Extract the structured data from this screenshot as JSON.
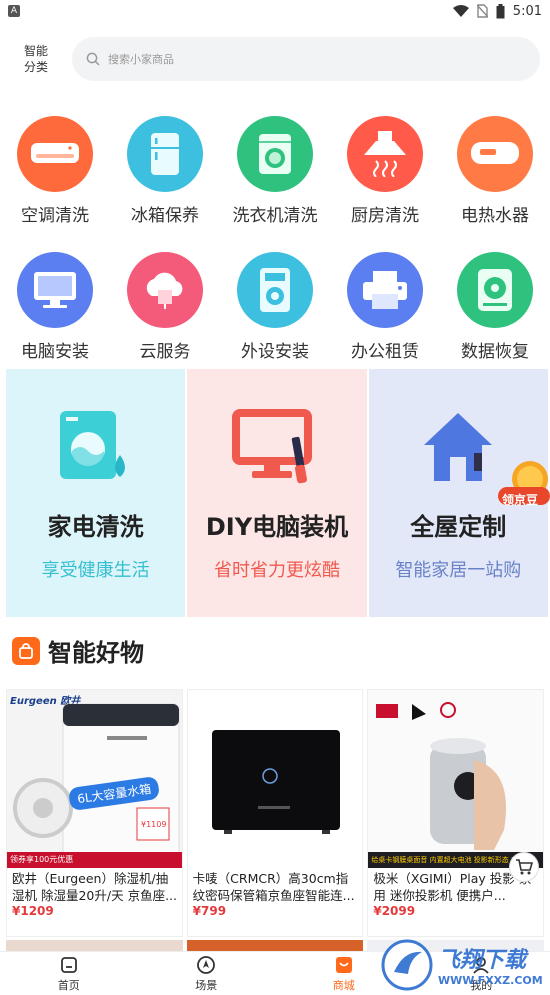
{
  "status_bar": {
    "app_badge": "A",
    "time": "5:01"
  },
  "header": {
    "category_label": "智能\n分类",
    "search_placeholder": "搜索小家商品"
  },
  "services_row1": [
    {
      "label": "空调清洗",
      "icon": "air-conditioner-icon",
      "color": "#ff6a3d"
    },
    {
      "label": "冰箱保养",
      "icon": "fridge-icon",
      "color": "#3dbfe0"
    },
    {
      "label": "洗衣机清洗",
      "icon": "washing-machine-icon",
      "color": "#2ec27e"
    },
    {
      "label": "厨房清洗",
      "icon": "range-hood-icon",
      "color": "#ff5a4a"
    },
    {
      "label": "电热水器",
      "icon": "water-heater-icon",
      "color": "#ff7a45"
    }
  ],
  "services_row2": [
    {
      "label": "电脑安装",
      "icon": "monitor-icon",
      "color": "#5b7ff0"
    },
    {
      "label": "云服务",
      "icon": "cloud-icon",
      "color": "#f45a7a"
    },
    {
      "label": "外设安装",
      "icon": "peripheral-icon",
      "color": "#3dbfe0"
    },
    {
      "label": "办公租赁",
      "icon": "printer-icon",
      "color": "#5b7ff0"
    },
    {
      "label": "数据恢复",
      "icon": "disk-icon",
      "color": "#2ec27e"
    }
  ],
  "features": [
    {
      "title": "家电清洗",
      "subtitle": "享受健康生活",
      "icon": "washer-drop-icon"
    },
    {
      "title": "DIY电脑装机",
      "subtitle": "省时省力更炫酷",
      "icon": "pc-build-icon"
    },
    {
      "title": "全屋定制",
      "subtitle": "智能家居一站购",
      "icon": "house-icon"
    }
  ],
  "promo_badge": "领京豆",
  "section_title": "智能好物",
  "products": [
    {
      "brand_text": "Eurgeen 欧井",
      "banner": "6L大容量水箱",
      "strip": "领券享100元优惠",
      "tag_price": "¥1109",
      "name": "欧井（Eurgeen）除湿机/抽湿机 除湿量20升/天 京鱼座...",
      "price": "¥1209"
    },
    {
      "name": "卡唛（CRMCR）高30cm指纹密码保管箱京鱼座智能连...",
      "price": "¥799"
    },
    {
      "strip": "给桌卡钢膜桌面音 内置超大电池 投影新形态 720P",
      "name": "极米（XGIMI）Play 投影 家用 迷你投影机 便携户...",
      "price": "¥2099"
    }
  ],
  "tabs": [
    {
      "label": "首页",
      "icon": "home-icon"
    },
    {
      "label": "场景",
      "icon": "scene-icon"
    },
    {
      "label": "商城",
      "icon": "store-icon"
    },
    {
      "label": "我的",
      "icon": "profile-icon"
    }
  ],
  "watermark": {
    "title": "飞翔下载",
    "url": "WWW.FXXZ.COM"
  },
  "colors": {
    "accent": "#ff6a1a",
    "price": "#e4393c"
  }
}
